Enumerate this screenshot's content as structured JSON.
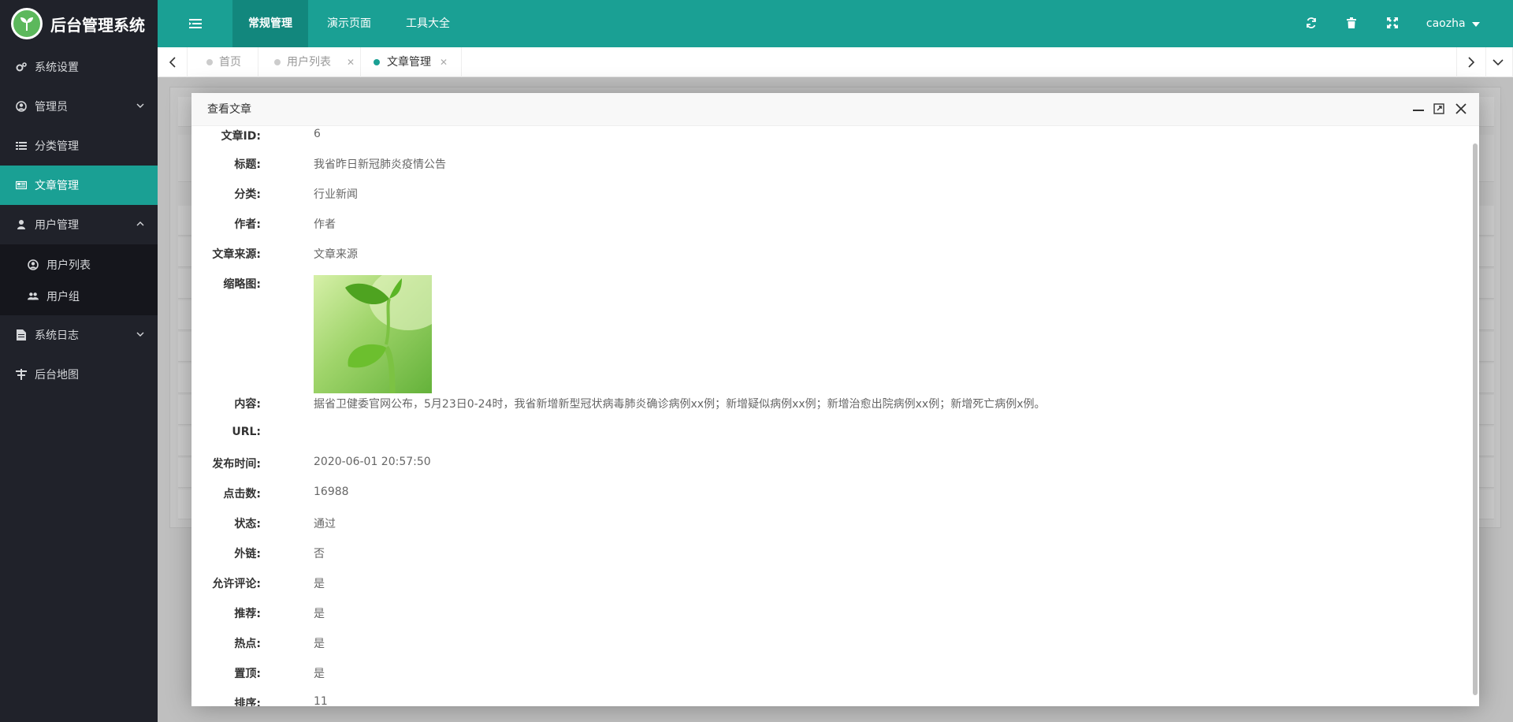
{
  "app": {
    "title": "后台管理系统"
  },
  "colors": {
    "brand": "#1aa094",
    "sidebar": "#20222a",
    "header": "#1aa094"
  },
  "sidebar": {
    "items": [
      {
        "label": "系统设置",
        "icon": "gears-icon"
      },
      {
        "label": "管理员",
        "icon": "user-circle-icon"
      },
      {
        "label": "分类管理",
        "icon": "list-icon"
      },
      {
        "label": "文章管理",
        "icon": "newspaper-icon"
      },
      {
        "label": "用户管理",
        "icon": "user-icon"
      },
      {
        "label": "用户列表",
        "icon": "user-circle-icon"
      },
      {
        "label": "用户组",
        "icon": "users-icon"
      },
      {
        "label": "系统日志",
        "icon": "file-icon"
      },
      {
        "label": "后台地图",
        "icon": "sitemap-icon"
      }
    ]
  },
  "header": {
    "tabs": [
      {
        "label": "常规管理"
      },
      {
        "label": "演示页面"
      },
      {
        "label": "工具大全"
      }
    ],
    "user": "caozha"
  },
  "pagetabs": [
    {
      "label": "首页"
    },
    {
      "label": "用户列表"
    },
    {
      "label": "文章管理"
    }
  ],
  "modal": {
    "title": "查看文章",
    "fields": [
      {
        "label": "文章ID:",
        "value": "6"
      },
      {
        "label": "标题:",
        "value": "我省昨日新冠肺炎疫情公告"
      },
      {
        "label": "分类:",
        "value": "行业新闻"
      },
      {
        "label": "作者:",
        "value": "作者"
      },
      {
        "label": "文章来源:",
        "value": "文章来源"
      },
      {
        "label": "缩略图:",
        "value": ""
      },
      {
        "label": "内容:",
        "value": "据省卫健委官网公布，5月23日0-24时，我省新增新型冠状病毒肺炎确诊病例xx例；新增疑似病例xx例；新增治愈出院病例xx例；新增死亡病例x例。"
      },
      {
        "label": "URL:",
        "value": ""
      },
      {
        "label": "发布时间:",
        "value": "2020-06-01 20:57:50"
      },
      {
        "label": "点击数:",
        "value": "16988"
      },
      {
        "label": "状态:",
        "value": "通过"
      },
      {
        "label": "外链:",
        "value": "否"
      },
      {
        "label": "允许评论:",
        "value": "是"
      },
      {
        "label": "推荐:",
        "value": "是"
      },
      {
        "label": "热点:",
        "value": "是"
      },
      {
        "label": "置顶:",
        "value": "是"
      },
      {
        "label": "排序:",
        "value": "11"
      }
    ]
  }
}
